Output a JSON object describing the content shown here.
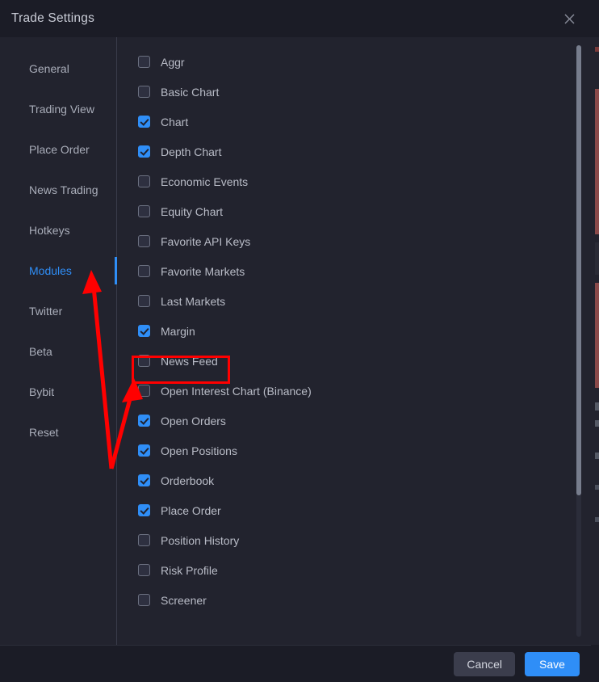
{
  "window": {
    "title": "Trade Settings",
    "close_icon": "close-icon"
  },
  "sidebar": {
    "items": [
      {
        "label": "General",
        "active": false
      },
      {
        "label": "Trading View",
        "active": false
      },
      {
        "label": "Place Order",
        "active": false
      },
      {
        "label": "News Trading",
        "active": false
      },
      {
        "label": "Hotkeys",
        "active": false
      },
      {
        "label": "Modules",
        "active": true
      },
      {
        "label": "Twitter",
        "active": false
      },
      {
        "label": "Beta",
        "active": false
      },
      {
        "label": "Bybit",
        "active": false
      },
      {
        "label": "Reset",
        "active": false
      }
    ]
  },
  "modules": {
    "items": [
      {
        "label": "Aggr",
        "checked": false
      },
      {
        "label": "Basic Chart",
        "checked": false
      },
      {
        "label": "Chart",
        "checked": true
      },
      {
        "label": "Depth Chart",
        "checked": true
      },
      {
        "label": "Economic Events",
        "checked": false
      },
      {
        "label": "Equity Chart",
        "checked": false
      },
      {
        "label": "Favorite API Keys",
        "checked": false
      },
      {
        "label": "Favorite Markets",
        "checked": false
      },
      {
        "label": "Last Markets",
        "checked": false
      },
      {
        "label": "Margin",
        "checked": true
      },
      {
        "label": "News Feed",
        "checked": false
      },
      {
        "label": "Open Interest Chart (Binance)",
        "checked": false
      },
      {
        "label": "Open Orders",
        "checked": true
      },
      {
        "label": "Open Positions",
        "checked": true
      },
      {
        "label": "Orderbook",
        "checked": true
      },
      {
        "label": "Place Order",
        "checked": true
      },
      {
        "label": "Position History",
        "checked": false
      },
      {
        "label": "Risk Profile",
        "checked": false
      },
      {
        "label": "Screener",
        "checked": false
      }
    ]
  },
  "footer": {
    "cancel_label": "Cancel",
    "save_label": "Save"
  },
  "colors": {
    "accent": "#2f8ef7",
    "dialog_bg": "#22232e",
    "chrome_bg": "#1b1c26",
    "annotation": "#ff0000"
  }
}
